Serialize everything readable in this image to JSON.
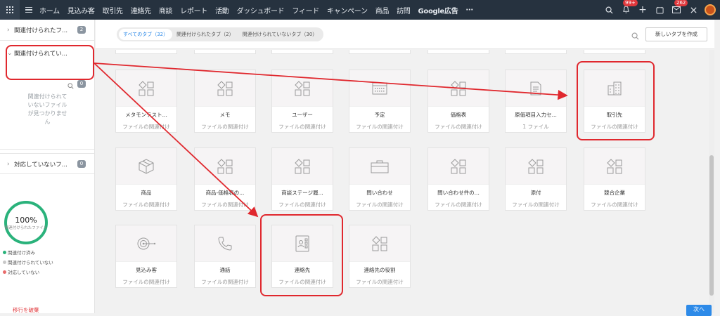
{
  "nav": {
    "items": [
      "ホーム",
      "見込み客",
      "取引先",
      "連絡先",
      "商談",
      "レポート",
      "活動",
      "ダッシュボード",
      "フィード",
      "キャンペーン",
      "商品",
      "訪問",
      "Google広告"
    ],
    "more": "···",
    "notif_badge": "99+",
    "mail_badge": "262"
  },
  "sidebar": {
    "sections": [
      {
        "label": "関連付けられたフ...",
        "count": "2"
      },
      {
        "label": "関連付けられてい...",
        "count": "0"
      },
      {
        "label": "対応していないフ...",
        "count": "0"
      }
    ],
    "empty_message": [
      "関連付けられて",
      "いないファイル",
      "が見つかりませ",
      "ん"
    ],
    "progress": {
      "percent": "100%",
      "label": "関連付けられたファイル",
      "value": 1.0
    },
    "legend": [
      {
        "label": "関連付け済み",
        "color": "#2ab27b"
      },
      {
        "label": "関連付けられていない",
        "color": "#c8c8c8"
      },
      {
        "label": "対応していない",
        "color": "#e86b6b"
      }
    ],
    "cancel_label": "移行を破棄"
  },
  "tabs": {
    "pills": [
      "すべてのタブ（32）",
      "関連付けられたタブ（2）",
      "関連付けられていないタブ（30）"
    ],
    "active": 0,
    "new_tab_label": "新しいタブを作成"
  },
  "cards": [
    {
      "name": "メタモンテスト...",
      "status": "ファイルの関連付け",
      "icon": "shapes-icon"
    },
    {
      "name": "メモ",
      "status": "ファイルの関連付け",
      "icon": "shapes-icon"
    },
    {
      "name": "ユーザー",
      "status": "ファイルの関連付け",
      "icon": "shapes-icon"
    },
    {
      "name": "予定",
      "status": "ファイルの関連付け",
      "icon": "calendar-icon"
    },
    {
      "name": "価格表",
      "status": "ファイルの関連付け",
      "icon": "shapes-icon"
    },
    {
      "name": "原価項目入力セ...",
      "status": "1 ファイル",
      "icon": "document-icon"
    },
    {
      "name": "取引先",
      "status": "ファイルの関連付け",
      "icon": "building-icon"
    },
    {
      "name": "商品",
      "status": "ファイルの関連付け",
      "icon": "box-icon"
    },
    {
      "name": "商品-価格表の...",
      "status": "ファイルの関連付け",
      "icon": "shapes-icon"
    },
    {
      "name": "商談ステージ履...",
      "status": "ファイルの関連付け",
      "icon": "shapes-icon"
    },
    {
      "name": "問い合わせ",
      "status": "ファイルの関連付け",
      "icon": "briefcase-icon"
    },
    {
      "name": "問い合わせ件の...",
      "status": "ファイルの関連付け",
      "icon": "shapes-icon"
    },
    {
      "name": "添付",
      "status": "ファイルの関連付け",
      "icon": "shapes-icon"
    },
    {
      "name": "競合企業",
      "status": "ファイルの関連付け",
      "icon": "shapes-icon"
    },
    {
      "name": "見込み客",
      "status": "ファイルの関連付け",
      "icon": "target-icon"
    },
    {
      "name": "通話",
      "status": "ファイルの関連付け",
      "icon": "phone-icon"
    },
    {
      "name": "連絡先",
      "status": "ファイルの関連付け",
      "icon": "contact-card-icon"
    },
    {
      "name": "連絡先の役割",
      "status": "ファイルの関連付け",
      "icon": "shapes-icon"
    }
  ],
  "partial_row_label": "ファイルの関連付け",
  "footer": {
    "next_label": "次へ"
  }
}
